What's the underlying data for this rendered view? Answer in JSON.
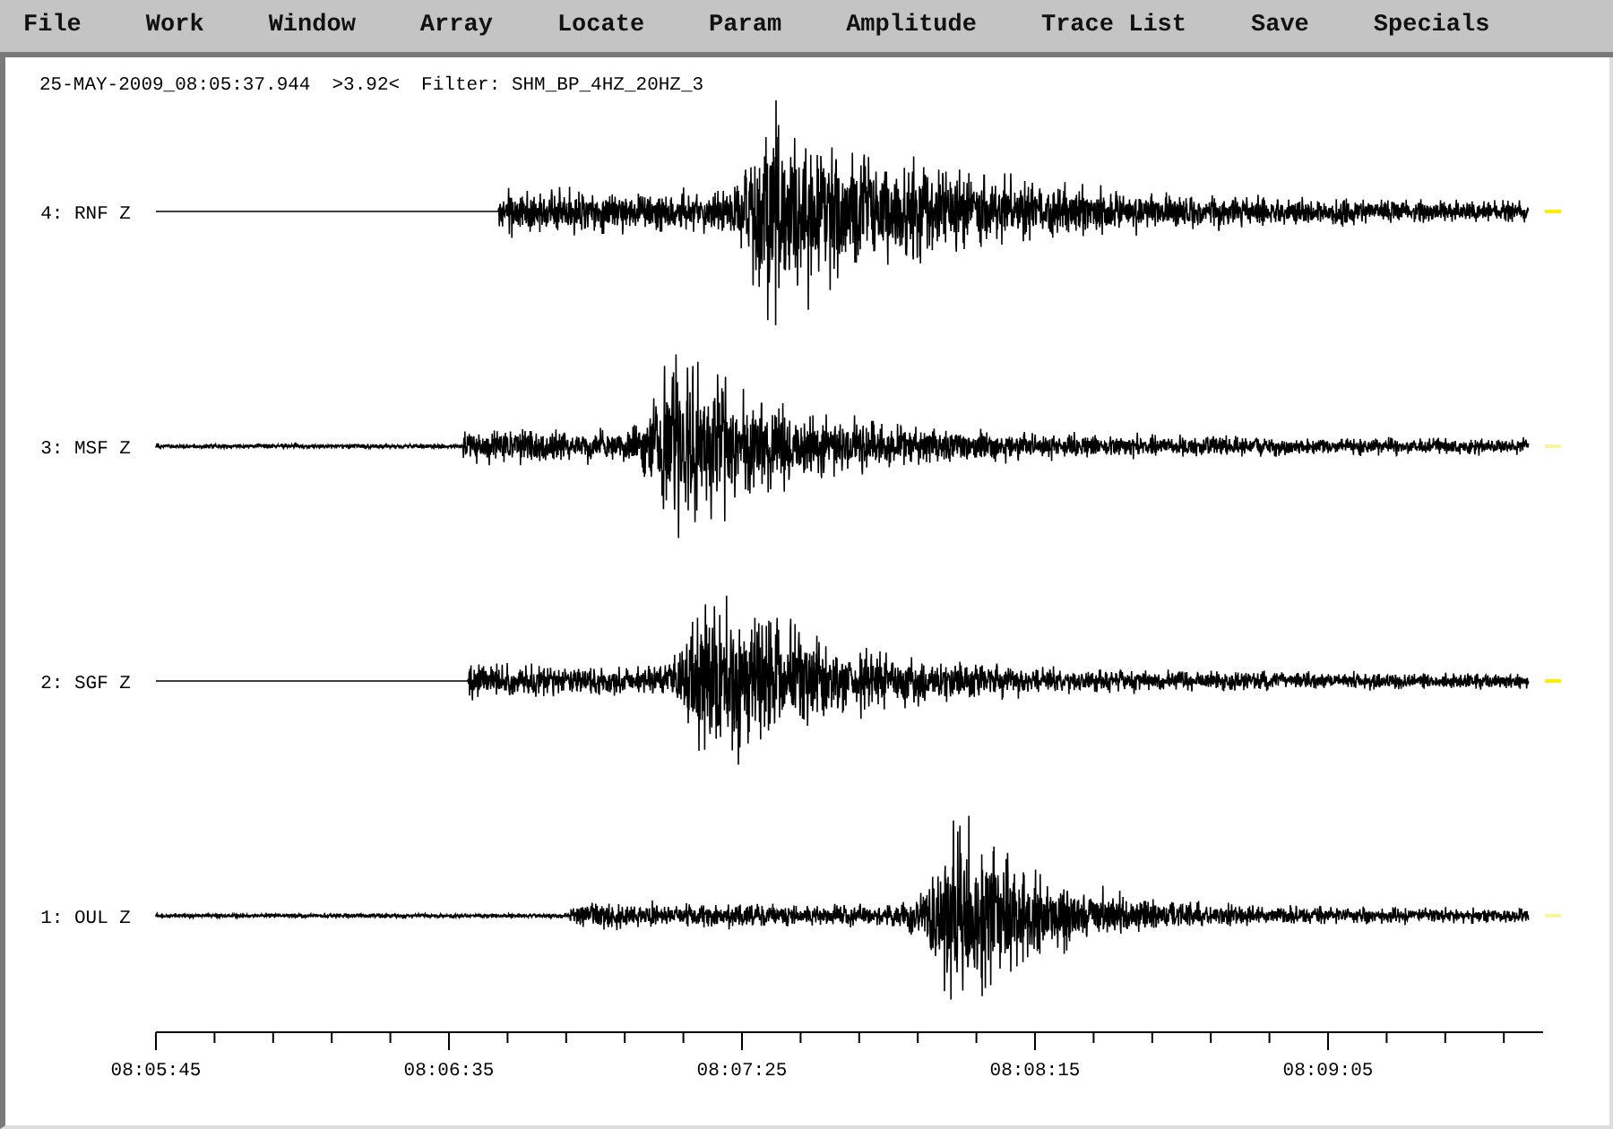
{
  "menu": [
    "File",
    "Work",
    "Window",
    "Array",
    "Locate",
    "Param",
    "Amplitude",
    "Trace List",
    "Save",
    "Specials"
  ],
  "header": {
    "time": "25-MAY-2009_08:05:37.944",
    "value": ">3.92<",
    "filter": "Filter: SHM_BP_4HZ_20HZ_3"
  },
  "traces": [
    {
      "label": "4: RNF Z",
      "marked": true
    },
    {
      "label": "3: MSF Z",
      "marked": false
    },
    {
      "label": "2: SGF Z",
      "marked": true
    },
    {
      "label": "1: OUL Z",
      "marked": false
    }
  ],
  "time_axis": {
    "labels": [
      "08:05:45",
      "08:06:35",
      "08:07:25",
      "08:08:15",
      "08:09:05"
    ]
  }
}
